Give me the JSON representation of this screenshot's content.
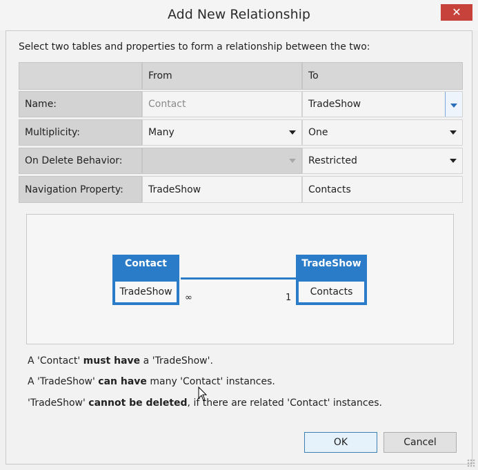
{
  "window": {
    "title": "Add New Relationship",
    "close_glyph": "✕"
  },
  "instruction": "Select two tables and properties to form a relationship between the two:",
  "grid": {
    "headers": {
      "from": "From",
      "to": "To"
    },
    "rows": [
      {
        "label": "Name:",
        "from": "Contact",
        "to": "TradeShow"
      },
      {
        "label": "Multiplicity:",
        "from": "Many",
        "to": "One"
      },
      {
        "label": "On Delete Behavior:",
        "from": "",
        "to": "Restricted"
      },
      {
        "label": "Navigation Property:",
        "from": "TradeShow",
        "to": "Contacts"
      }
    ]
  },
  "diagram": {
    "left_entity": {
      "name": "Contact",
      "property": "TradeShow"
    },
    "right_entity": {
      "name": "TradeShow",
      "property": "Contacts"
    },
    "left_multiplicity": "∞",
    "right_multiplicity": "1"
  },
  "messages": [
    {
      "pre": "A 'Contact' ",
      "bold": "must have",
      "post": " a 'TradeShow'."
    },
    {
      "pre": "A 'TradeShow' ",
      "bold": "can have",
      "post": " many 'Contact' instances."
    },
    {
      "pre": "'TradeShow' ",
      "bold": "cannot be deleted",
      "post": ", if there are related 'Contact' instances."
    }
  ],
  "buttons": {
    "ok": "OK",
    "cancel": "Cancel"
  },
  "colors": {
    "entity": "#2a7bc8",
    "close": "#c7423b",
    "focus_border": "#3c7fb1"
  }
}
